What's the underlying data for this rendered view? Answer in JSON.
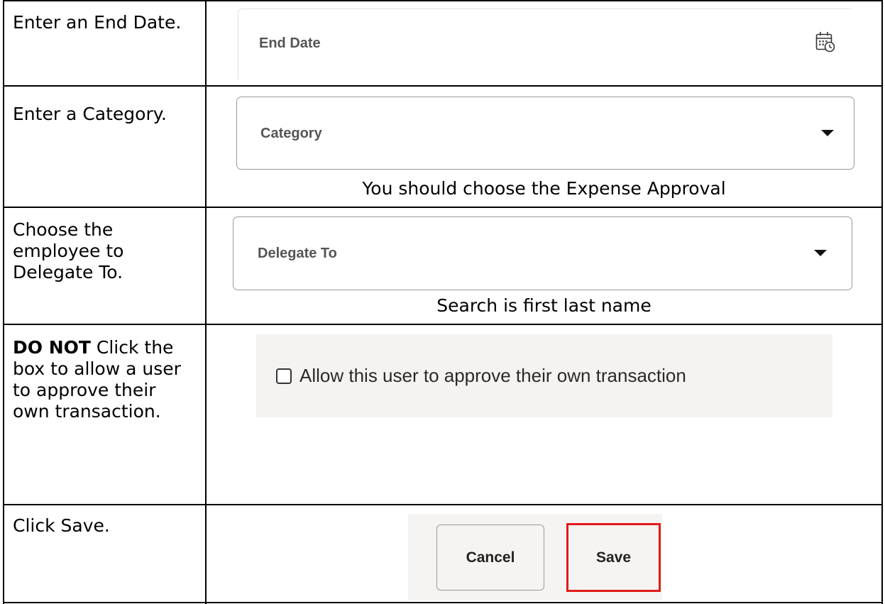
{
  "rows": [
    {
      "instruction": "Enter an End Date."
    },
    {
      "instruction": "Enter a Category.",
      "note": "You should choose the Expense Approval"
    },
    {
      "instruction": "Choose the employee to Delegate To.",
      "note": "Search is first last name"
    },
    {
      "instruction_bold": "DO NOT",
      "instruction_rest": " Click the box to allow a user to approve their own transaction."
    },
    {
      "instruction": "Click Save."
    }
  ],
  "end_date": {
    "label": "End Date",
    "icon": "calendar-clock-icon"
  },
  "category": {
    "label": "Category",
    "icon": "caret-down-icon"
  },
  "delegate_to": {
    "label": "Delegate To",
    "icon": "caret-down-icon"
  },
  "allow_self_approval": {
    "label": "Allow this user to approve their own transaction",
    "checked": false
  },
  "buttons": {
    "cancel_label": "Cancel",
    "save_label": "Save",
    "highlight_color": "#e01b1b"
  }
}
